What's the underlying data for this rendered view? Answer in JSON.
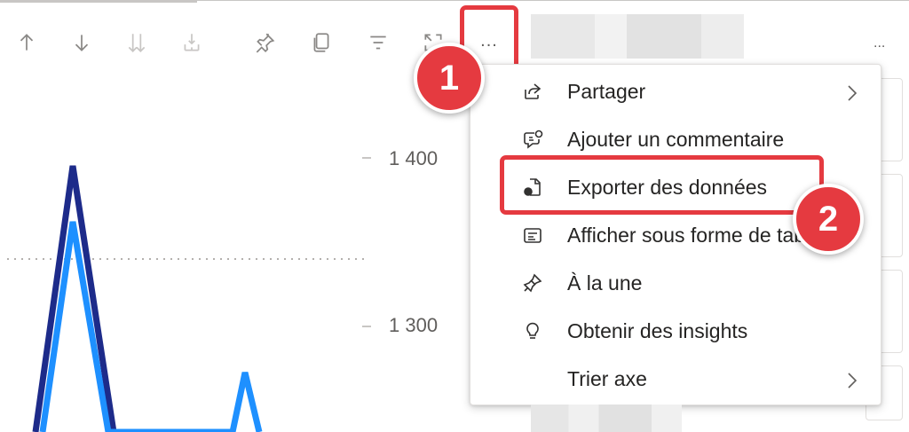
{
  "toolbar": {
    "icons": [
      "sort-ascending-icon",
      "sort-descending-icon",
      "sort-both-icon",
      "expand-hierarchy-icon",
      "pin-icon",
      "copy-visual-icon",
      "filter-icon",
      "focus-mode-icon"
    ],
    "more_options_label": "..."
  },
  "right_panel": {
    "more_options_label": "..."
  },
  "chart_data": {
    "type": "line",
    "yticks": [
      "1 400",
      "1 300"
    ],
    "series": [
      {
        "color": "#1d2b8a"
      },
      {
        "color": "#1e90ff"
      }
    ]
  },
  "context_menu": {
    "items": [
      {
        "label": "Partager",
        "icon": "share-icon",
        "has_submenu": true
      },
      {
        "label": "Ajouter un commentaire",
        "icon": "comment-icon",
        "has_submenu": false
      },
      {
        "label": "Exporter des données",
        "icon": "export-data-icon",
        "has_submenu": false
      },
      {
        "label": "Afficher sous forme de table",
        "icon": "table-view-icon",
        "has_submenu": false
      },
      {
        "label": "À la une",
        "icon": "spotlight-icon",
        "has_submenu": false
      },
      {
        "label": "Obtenir des insights",
        "icon": "insights-icon",
        "has_submenu": false
      },
      {
        "label": "Trier axe",
        "icon": "",
        "has_submenu": true
      }
    ]
  },
  "annotations": {
    "step1": "1",
    "step2": "2",
    "accent_color": "#e53a40"
  }
}
